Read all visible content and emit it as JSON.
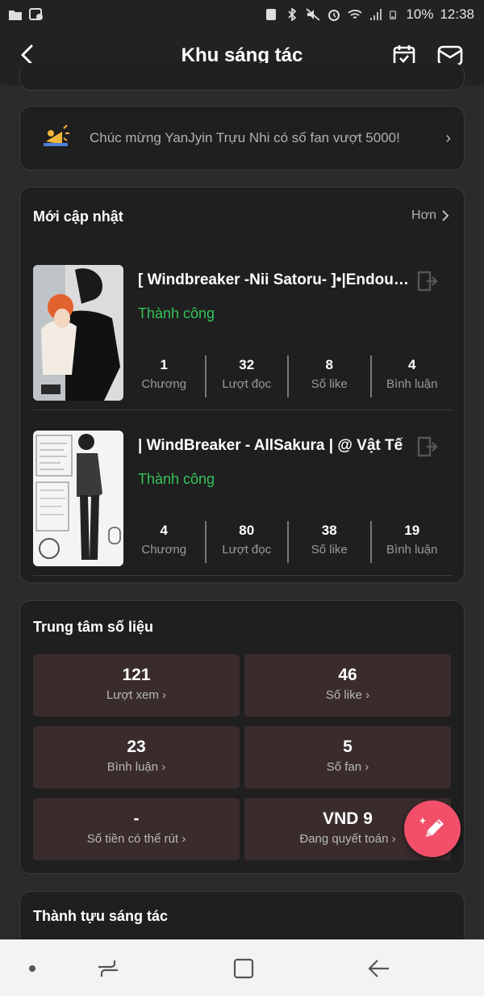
{
  "status_bar": {
    "battery": "10%",
    "time": "12:38"
  },
  "app_bar": {
    "title": "Khu sáng tác",
    "icons": [
      "back-icon",
      "calendar-check-icon",
      "mail-icon"
    ]
  },
  "congrats": {
    "text": "Chúc mừng YanJyin Trựu Nhi có số fan vượt 5000!",
    "icon": "megaphone-icon"
  },
  "recent": {
    "title": "Mới cập nhật",
    "more_label": "Hơn",
    "works": [
      {
        "title": "[ Windbreaker -Nii Satoru- ]•|Endou Satoru",
        "status": "Thành công",
        "stats": [
          {
            "value": "1",
            "label": "Chương"
          },
          {
            "value": "32",
            "label": "Lượt đọc"
          },
          {
            "value": "8",
            "label": "Số like"
          },
          {
            "value": "4",
            "label": "Bình luận"
          }
        ]
      },
      {
        "title": "| WindBreaker - AllSakura | @ Vật Tế",
        "status": "Thành công",
        "stats": [
          {
            "value": "4",
            "label": "Chương"
          },
          {
            "value": "80",
            "label": "Lượt đọc"
          },
          {
            "value": "38",
            "label": "Số like"
          },
          {
            "value": "19",
            "label": "Bình luận"
          }
        ]
      }
    ]
  },
  "metrics": {
    "title": "Trung tâm số liệu",
    "tiles": [
      {
        "value": "121",
        "label": "Lượt xem"
      },
      {
        "value": "46",
        "label": "Số like"
      },
      {
        "value": "23",
        "label": "Bình luận"
      },
      {
        "value": "5",
        "label": "Số fan"
      },
      {
        "value": "-",
        "label": "Số tiền có thể rút"
      },
      {
        "value": "VND 9",
        "label": "Đang quyết toán"
      }
    ]
  },
  "achievements": {
    "title": "Thành tựu sáng tác"
  },
  "colors": {
    "success": "#35c35a",
    "fab": "#f2506a",
    "tile": "#3a2c2c"
  }
}
